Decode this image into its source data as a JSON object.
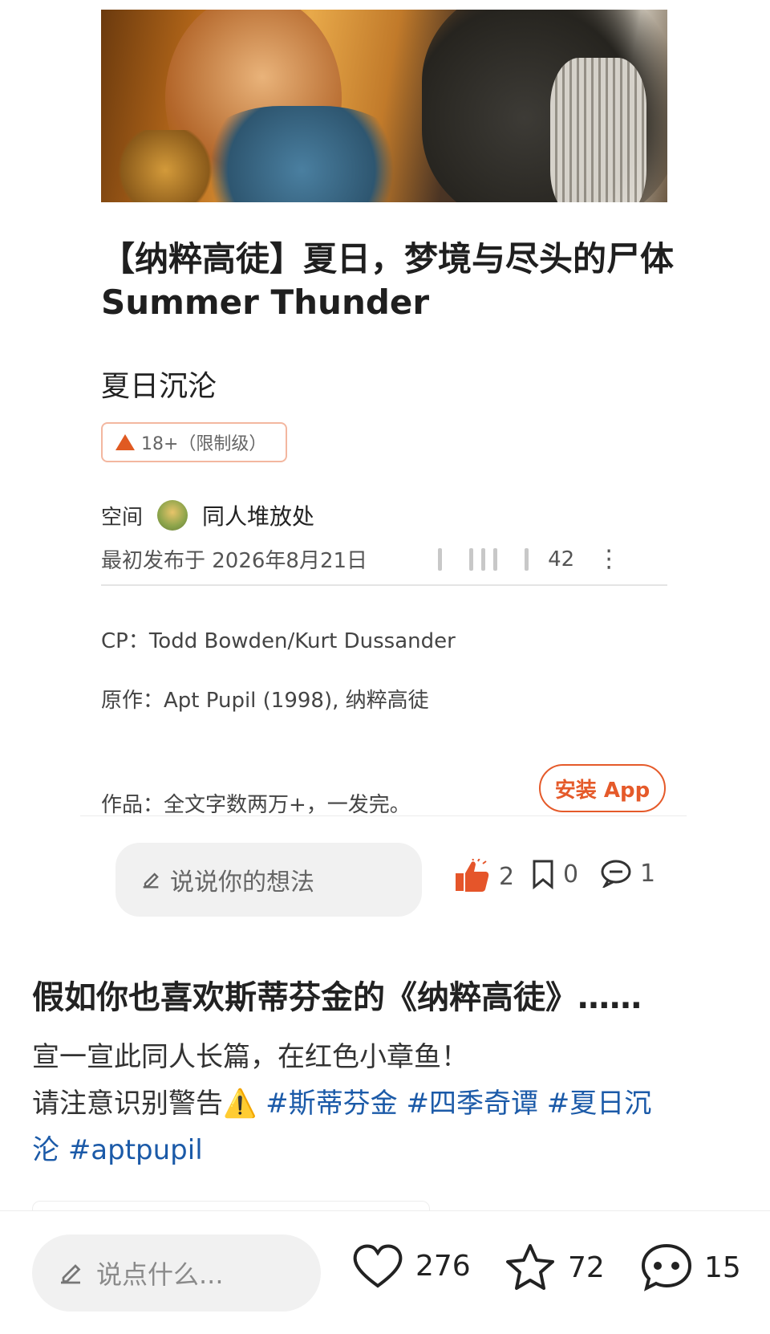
{
  "post_card": {
    "title": "【纳粹高徒】夏日，梦境与尽头的尸体 Summer Thunder",
    "subtitle": "夏日沉沦",
    "rating_label": "18+（限制级）",
    "space_label": "空间",
    "space_name": "同人堆放处",
    "published": "最初发布于 2026年8月21日",
    "views": "42",
    "cp_line": "CP：Todd Bowden/Kurt Dussander",
    "source_line": "原作：Apt Pupil (1998), 纳粹高徒",
    "work_line": "作品：全文字数两万+，一发完。",
    "install_button": "安装 App",
    "comment_placeholder": "说说你的想法",
    "likes": "2",
    "bookmarks": "0",
    "comments": "1"
  },
  "post": {
    "title": "假如你也喜欢斯蒂芬金的《纳粹高徒》……",
    "line1": "宣一宣此同人长篇，在红色小章鱼！",
    "line2_prefix": "请注意识别警告",
    "warning_icon": "⚠️",
    "tags": [
      "#斯蒂芬金",
      "#四季奇谭",
      "#夏日沉",
      "沦",
      "#aptpupil"
    ]
  },
  "bottom_bar": {
    "placeholder": "说点什么...",
    "likes": "276",
    "favorites": "72",
    "comments": "15"
  },
  "colors": {
    "accent": "#e55a2a",
    "tag": "#1b5aa8"
  }
}
